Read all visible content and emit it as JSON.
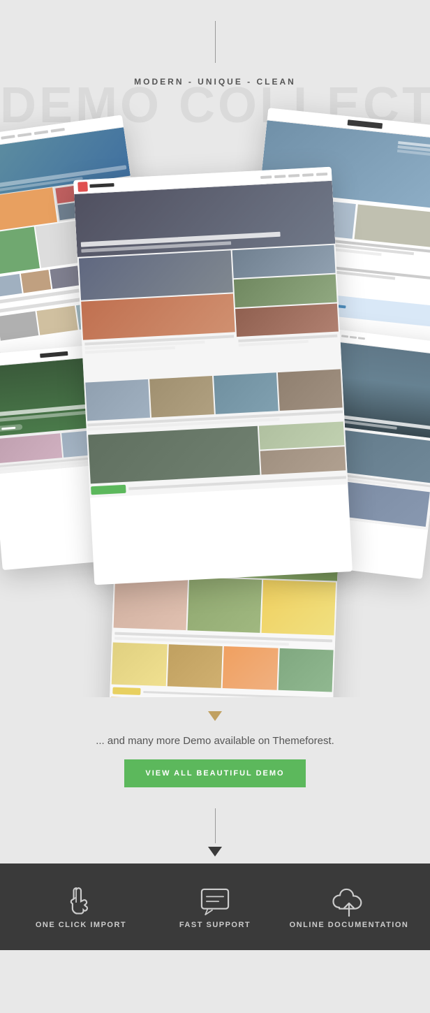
{
  "header": {
    "divider_visible": true,
    "subtitle": "MODERN - UNIQUE - CLEAN",
    "bg_title": "DEMO COLLECTION"
  },
  "demos": {
    "label": "Demo Collection",
    "items": [
      {
        "id": "demo1",
        "style": "magazine",
        "rotation": "-8deg"
      },
      {
        "id": "demo2",
        "style": "minimal-blog",
        "rotation": "6deg"
      },
      {
        "id": "demo3",
        "style": "main-magazine",
        "rotation": "-3deg"
      },
      {
        "id": "demo4",
        "style": "beauty-lifestyle",
        "rotation": "-5deg"
      },
      {
        "id": "demo5",
        "style": "colorful-blog",
        "rotation": "2deg"
      },
      {
        "id": "demo6",
        "style": "outdoor",
        "rotation": "7deg"
      }
    ]
  },
  "arrow": {
    "color": "#c0a060"
  },
  "more_demos": {
    "text": "... and many more Demo available on Themeforest.",
    "button_label": "VIEW ALL BEAUTIFUL DEMO"
  },
  "footer": {
    "background": "#3a3a3a",
    "items": [
      {
        "id": "one-click-import",
        "label": "ONE CLICK IMPORT",
        "icon": "hand-pointer"
      },
      {
        "id": "fast-support",
        "label": "FAST SUPPORT",
        "icon": "chat-bubble"
      },
      {
        "id": "online-documentation",
        "label": "ONLINE DOCUMENTATION",
        "icon": "cloud-upload"
      }
    ]
  }
}
